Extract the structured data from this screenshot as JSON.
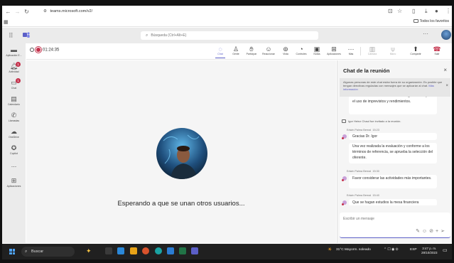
{
  "browser": {
    "url": "teams.microsoft.com/v2/",
    "favorites_label": "Todos los favoritos"
  },
  "teams_header": {
    "search_placeholder": "Búsqueda (Ctrl+Alt+E)"
  },
  "rail": {
    "items": [
      {
        "label": "Aplicación E...",
        "icon": "apps-icon"
      },
      {
        "label": "Actividad",
        "icon": "bell-icon",
        "badge": "1"
      },
      {
        "label": "Chat",
        "icon": "chat-icon",
        "badge": "1"
      },
      {
        "label": "Calendario",
        "icon": "calendar-icon"
      },
      {
        "label": "Llamadas",
        "icon": "phone-icon"
      },
      {
        "label": "OneDrive",
        "icon": "cloud-icon"
      },
      {
        "label": "Copilot",
        "icon": "copilot-icon"
      },
      {
        "label": "...",
        "icon": "more-icon"
      },
      {
        "label": "Aplicaciones",
        "icon": "plus-icon"
      }
    ]
  },
  "meeting": {
    "timer": "01:24:35",
    "toolbar": [
      {
        "label": "Chat",
        "icon": "chat-icon",
        "active": true
      },
      {
        "label": "Gente",
        "icon": "people-icon"
      },
      {
        "label": "Participar",
        "icon": "hand-icon"
      },
      {
        "label": "Reaccionar",
        "icon": "smile-icon"
      },
      {
        "label": "Vista",
        "icon": "view-icon"
      },
      {
        "label": "Controles",
        "icon": "controls-icon"
      },
      {
        "label": "Notas",
        "icon": "notes-icon"
      },
      {
        "label": "Aplicaciones",
        "icon": "apps-add-icon"
      },
      {
        "label": "Más",
        "icon": "more-icon"
      },
      {
        "label": "Cámara",
        "icon": "camera-icon",
        "dim": true
      },
      {
        "label": "Micro",
        "icon": "mic-icon",
        "dim": true
      },
      {
        "label": "Compartir",
        "icon": "share-icon"
      },
      {
        "label": "Salir",
        "icon": "leave-icon"
      }
    ],
    "waiting_text": "Esperando a que se unan otros usuarios..."
  },
  "chat": {
    "title": "Chat de la reunión",
    "notice": "Algunas personas de este chat están fuera de su organización. Es posible que tengan directivas reguladas con mensajes que se aplicarán al chat.",
    "notice_link": "Más información",
    "messages": [
      {
        "kind": "bubble",
        "text": "el Orden del Día a solicitud de la organización para el uso de imprevistos y rendimientos."
      },
      {
        "kind": "system",
        "text": "Igor Heinz Chaul fue invitado a la reunión."
      },
      {
        "kind": "meta",
        "author": "Edwin Palma Bernal",
        "time": "15:23"
      },
      {
        "kind": "bubble",
        "text": "Gracias Dr. Igor"
      },
      {
        "kind": "bubble",
        "text": "Una vez realizada la evaluación y conforme a los términos de referencia, se aprueba la selección del oferente."
      },
      {
        "kind": "meta",
        "author": "Edwin Palma Bernal",
        "time": "15:30"
      },
      {
        "kind": "bubble",
        "text": "Favor considerar las actividades más importantes."
      },
      {
        "kind": "meta",
        "author": "Edwin Palma Bernal",
        "time": "15:40"
      },
      {
        "kind": "bubble",
        "text": "Que se hagan estudios la mesa financiera"
      }
    ],
    "compose_placeholder": "Escribir un mensaje"
  },
  "taskbar": {
    "search_label": "Buscar",
    "weather": "31°C  Mayorm. soleado",
    "lang": "ESP",
    "time": "3:47 p. m.",
    "date": "28/10/2023"
  },
  "colors": {
    "accent": "#5b5fc7",
    "alert": "#c4314b",
    "rail_bg": "#ebebeb",
    "taskbar_bg": "#202020"
  }
}
